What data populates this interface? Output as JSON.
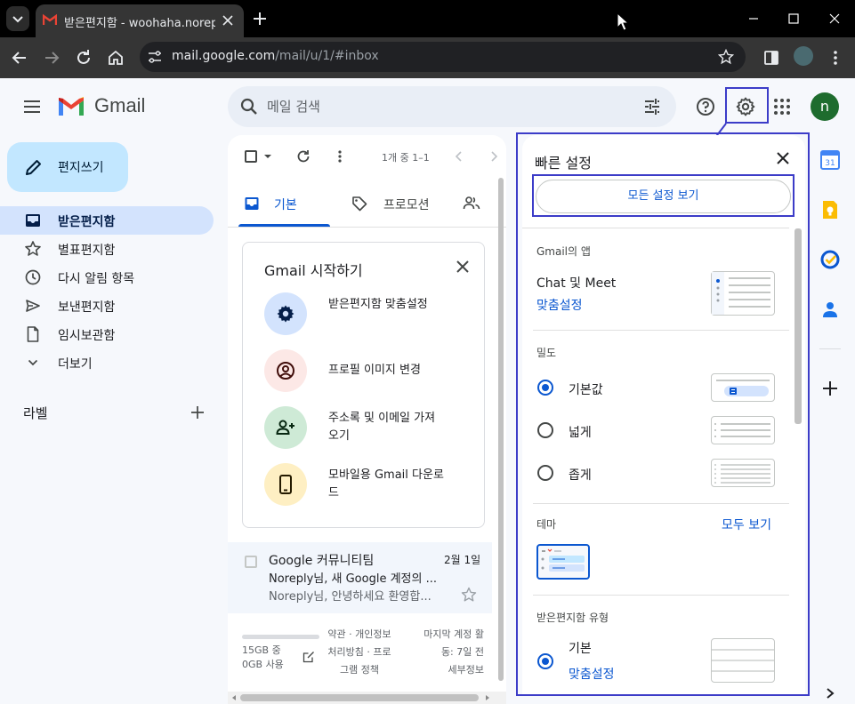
{
  "browser": {
    "tab_title": "받은편지함 - woohaha.noreply@",
    "url_host": "mail.google.com",
    "url_path": "/mail/u/1/#inbox"
  },
  "gmail": {
    "logo_text": "Gmail",
    "search_placeholder": "메일 검색",
    "avatar_letter": "n"
  },
  "sidebar": {
    "compose": "편지쓰기",
    "items": [
      {
        "label": "받은편지함",
        "icon": "inbox-icon"
      },
      {
        "label": "별표편지함",
        "icon": "star-icon"
      },
      {
        "label": "다시 알림 항목",
        "icon": "clock-icon"
      },
      {
        "label": "보낸편지함",
        "icon": "send-icon"
      },
      {
        "label": "임시보관함",
        "icon": "draft-icon"
      },
      {
        "label": "더보기",
        "icon": "chevron-down-icon"
      }
    ],
    "labels_title": "라벨"
  },
  "list": {
    "pager": "1개 중 1–1",
    "tabs": [
      "기본",
      "프로모션"
    ],
    "start_card": {
      "title": "Gmail 시작하기",
      "steps": [
        {
          "label": "받은편지함 맞춤설정",
          "color": "#d3e3fd"
        },
        {
          "label": "프로필 이미지 변경",
          "color": "#fce8e6"
        },
        {
          "label": "주소록 및 이메일 가져오기",
          "color": "#ceead6"
        },
        {
          "label": "모바일용 Gmail 다운로드",
          "color": "#feefc3"
        }
      ]
    },
    "email": {
      "sender": "Google 커뮤니티팀",
      "date": "2월 1일",
      "subject": "Noreply님, 새 Google 계정의 ...",
      "snippet": "Noreply님, 안녕하세요 환영합..."
    },
    "footer": {
      "storage": "15GB 중\n0GB 사용",
      "policy": "약관 · 개인정보\n처리방침 · 프로\n그램 정책",
      "activity": "마지막 계정 활\n동: 7일 전\n세부정보"
    }
  },
  "quick_settings": {
    "title": "빠른 설정",
    "all_settings": "모든 설정 보기",
    "apps": {
      "heading": "Gmail의 앱",
      "title": "Chat 및 Meet",
      "link": "맞춤설정"
    },
    "density": {
      "heading": "밀도",
      "options": [
        {
          "label": "기본값",
          "selected": true
        },
        {
          "label": "넓게",
          "selected": false
        },
        {
          "label": "좁게",
          "selected": false
        }
      ]
    },
    "theme": {
      "heading": "테마",
      "link": "모두 보기"
    },
    "inbox_type": {
      "heading": "받은편지함 유형",
      "option": "기본",
      "link": "맞춤설정"
    }
  },
  "colors": {
    "accent": "#0b57d0",
    "annotation": "#3c3cc8",
    "compose_bg": "#c2e7ff",
    "active_nav": "#d3e3fd"
  }
}
